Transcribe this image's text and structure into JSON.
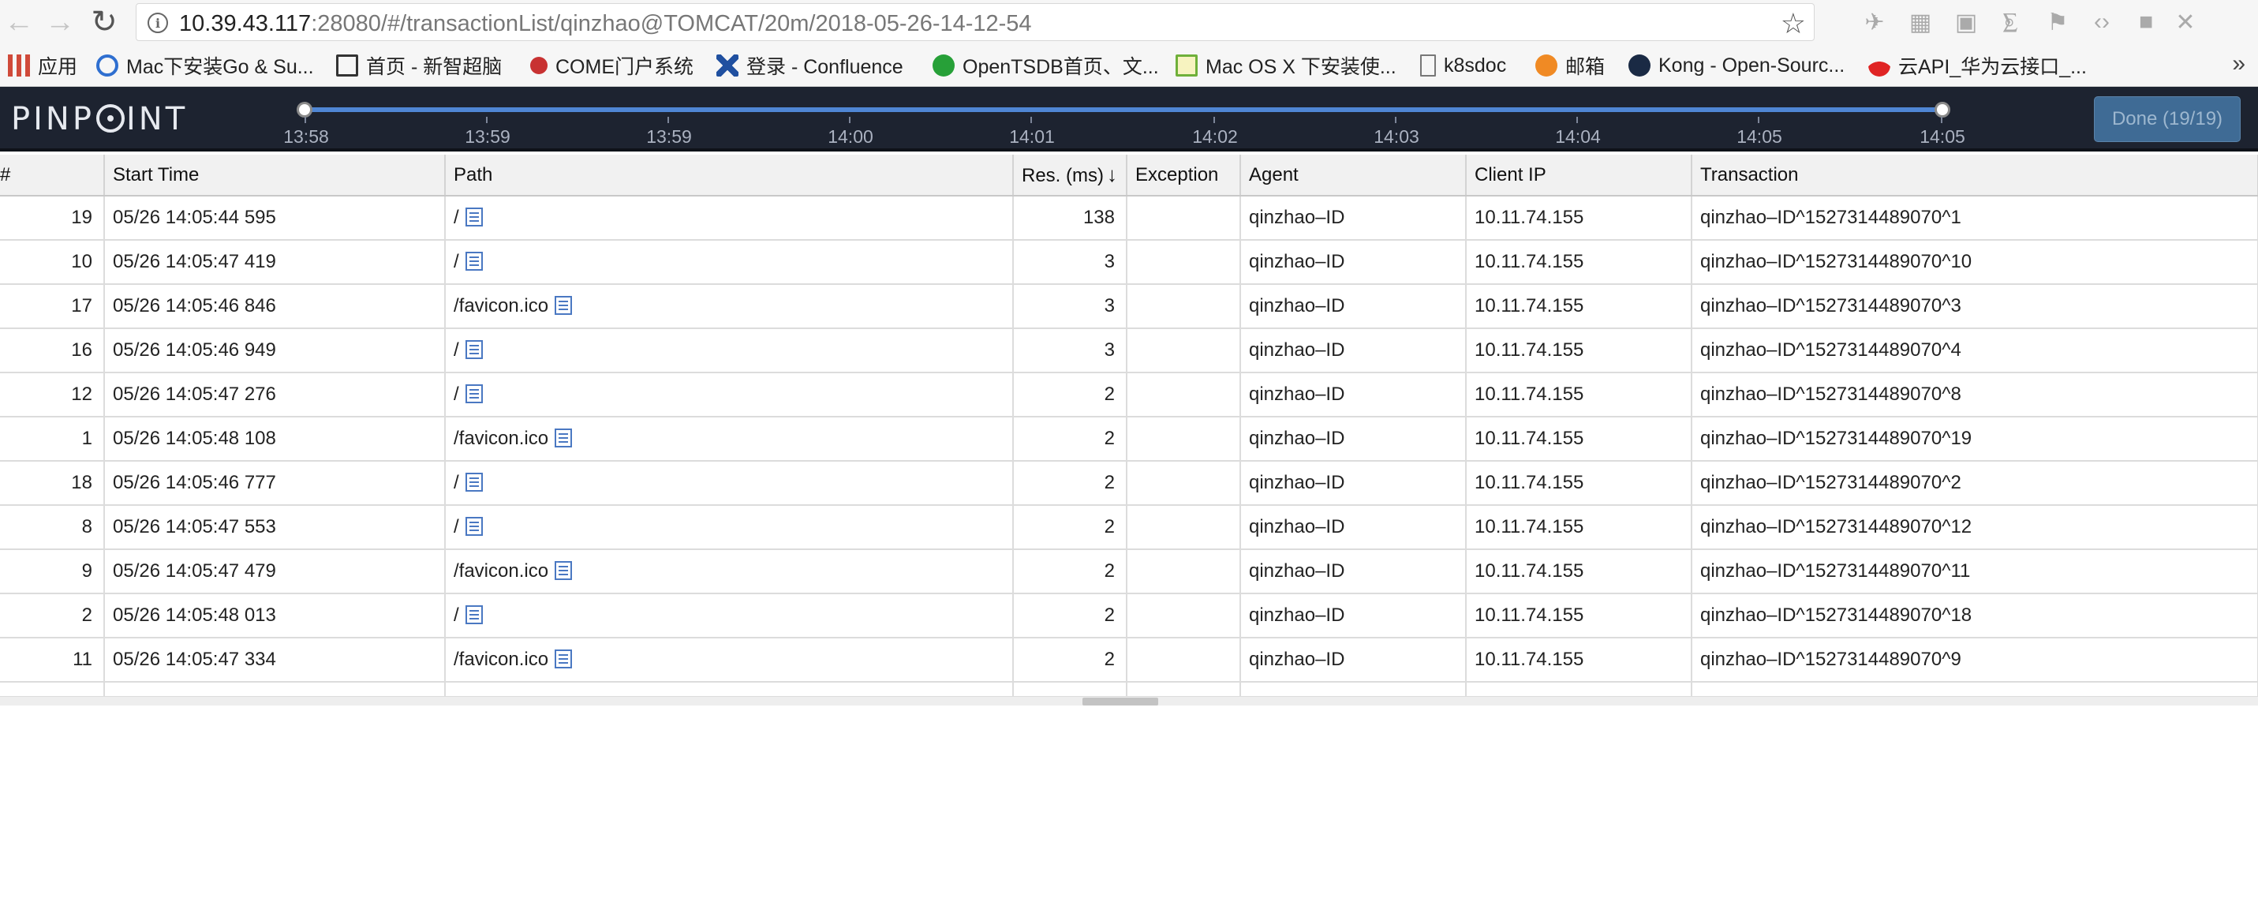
{
  "browser": {
    "url_host": "10.39.43.117",
    "url_rest": ":28080/#/transactionList/qinzhao@TOMCAT/20m/2018-05-26-14-12-54",
    "bookmarks": [
      {
        "label": "应用",
        "icon": "apps-grid-icon",
        "color": "#d04a3a"
      },
      {
        "label": "Mac下安装Go & Su...",
        "icon": "c-logo-icon",
        "color": "#2f6fd0"
      },
      {
        "label": "首页 - 新智超脑",
        "icon": "edit-icon",
        "color": "#333333"
      },
      {
        "label": "COME门户系统",
        "icon": "come-logo-icon",
        "color": "#c83232"
      },
      {
        "label": "登录 - Confluence",
        "icon": "confluence-icon",
        "color": "#2050a0"
      },
      {
        "label": "OpenTSDB首页、文...",
        "icon": "opentsdb-icon",
        "color": "#27a038"
      },
      {
        "label": "Mac OS X 下安装使...",
        "icon": "note-icon",
        "color": "#6fb03a"
      },
      {
        "label": "k8sdoc",
        "icon": "file-icon",
        "color": "#777777"
      },
      {
        "label": "邮箱",
        "icon": "mail-icon",
        "color": "#f08a24"
      },
      {
        "label": "Kong - Open-Sourc...",
        "icon": "kong-icon",
        "color": "#1a2a44"
      },
      {
        "label": "云API_华为云接口_...",
        "icon": "huawei-icon",
        "color": "#e02424"
      }
    ],
    "more_label": "»"
  },
  "header": {
    "logo": "PINPOINT",
    "timeline_labels": [
      "13:58",
      "13:59",
      "13:59",
      "14:00",
      "14:01",
      "14:02",
      "14:03",
      "14:04",
      "14:05",
      "14:05"
    ],
    "done_label": "Done (19/19)"
  },
  "table": {
    "columns": [
      "#",
      "Start Time",
      "Path",
      "Res. (ms)",
      "Exception",
      "Agent",
      "Client IP",
      "Transaction"
    ],
    "sort_indicator": "↓",
    "rows": [
      {
        "num": "19",
        "start": "05/26 14:05:44 595",
        "path": "/",
        "res": "138",
        "exception": "",
        "agent": "qinzhao–ID",
        "ip": "10.11.74.155",
        "tx": "qinzhao–ID^1527314489070^1"
      },
      {
        "num": "10",
        "start": "05/26 14:05:47 419",
        "path": "/",
        "res": "3",
        "exception": "",
        "agent": "qinzhao–ID",
        "ip": "10.11.74.155",
        "tx": "qinzhao–ID^1527314489070^10"
      },
      {
        "num": "17",
        "start": "05/26 14:05:46 846",
        "path": "/favicon.ico",
        "res": "3",
        "exception": "",
        "agent": "qinzhao–ID",
        "ip": "10.11.74.155",
        "tx": "qinzhao–ID^1527314489070^3"
      },
      {
        "num": "16",
        "start": "05/26 14:05:46 949",
        "path": "/",
        "res": "3",
        "exception": "",
        "agent": "qinzhao–ID",
        "ip": "10.11.74.155",
        "tx": "qinzhao–ID^1527314489070^4"
      },
      {
        "num": "12",
        "start": "05/26 14:05:47 276",
        "path": "/",
        "res": "2",
        "exception": "",
        "agent": "qinzhao–ID",
        "ip": "10.11.74.155",
        "tx": "qinzhao–ID^1527314489070^8"
      },
      {
        "num": "1",
        "start": "05/26 14:05:48 108",
        "path": "/favicon.ico",
        "res": "2",
        "exception": "",
        "agent": "qinzhao–ID",
        "ip": "10.11.74.155",
        "tx": "qinzhao–ID^1527314489070^19"
      },
      {
        "num": "18",
        "start": "05/26 14:05:46 777",
        "path": "/",
        "res": "2",
        "exception": "",
        "agent": "qinzhao–ID",
        "ip": "10.11.74.155",
        "tx": "qinzhao–ID^1527314489070^2"
      },
      {
        "num": "8",
        "start": "05/26 14:05:47 553",
        "path": "/",
        "res": "2",
        "exception": "",
        "agent": "qinzhao–ID",
        "ip": "10.11.74.155",
        "tx": "qinzhao–ID^1527314489070^12"
      },
      {
        "num": "9",
        "start": "05/26 14:05:47 479",
        "path": "/favicon.ico",
        "res": "2",
        "exception": "",
        "agent": "qinzhao–ID",
        "ip": "10.11.74.155",
        "tx": "qinzhao–ID^1527314489070^11"
      },
      {
        "num": "2",
        "start": "05/26 14:05:48 013",
        "path": "/",
        "res": "2",
        "exception": "",
        "agent": "qinzhao–ID",
        "ip": "10.11.74.155",
        "tx": "qinzhao–ID^1527314489070^18"
      },
      {
        "num": "11",
        "start": "05/26 14:05:47 334",
        "path": "/favicon.ico",
        "res": "2",
        "exception": "",
        "agent": "qinzhao–ID",
        "ip": "10.11.74.155",
        "tx": "qinzhao–ID^1527314489070^9"
      }
    ]
  },
  "colors": {
    "header_bg": "#1d2330",
    "timeline": "#4f86d4",
    "done_button": "#3f6b95",
    "link_icon": "#4a78c2",
    "watermark": "#e32424"
  }
}
